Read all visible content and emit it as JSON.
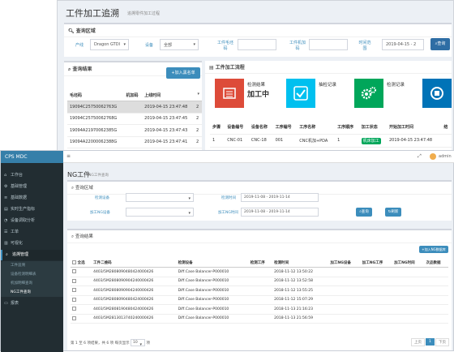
{
  "back": {
    "title": "工件加工追溯",
    "subtitle": "追溯零件加工过程",
    "query": {
      "header": "查询区域",
      "line_label": "产线",
      "line_value": "Dragon GTDI",
      "device_label": "设备",
      "device_value": "全部",
      "part_no_label": "工件毛坯码",
      "part_no_value": "",
      "machine_no_label": "工件机加码",
      "machine_no_value": "",
      "time_label": "时间范围",
      "time_value": "2019-04-15 - 2",
      "query_button": "查询"
    },
    "results": {
      "header": "查询结果",
      "add_blacklist_button": "加入黑名单",
      "columns": [
        "毛坯码",
        "机加码",
        "上线时间",
        ""
      ],
      "rows": [
        [
          "19094C25750062763G",
          "",
          "2019-04-15 23:47:48",
          "2"
        ],
        [
          "19094C25750062768G",
          "",
          "2019-04-15 23:47:45",
          "2"
        ],
        [
          "19094A21970062385G",
          "",
          "2019-04-15 23:47:43",
          "2"
        ],
        [
          "19094A22000062388G",
          "",
          "2019-04-15 23:47:41",
          "2"
        ]
      ]
    },
    "process": {
      "header": "工件加工流程",
      "cards": [
        {
          "label": "检测结果",
          "value": "加工中",
          "color": "#dd4b39",
          "icon": "list-icon"
        },
        {
          "label": "抽检记录",
          "value": "",
          "color": "#00c0ef",
          "icon": "check-icon"
        },
        {
          "label": "检测记录",
          "value": "",
          "color": "#00a65a",
          "icon": "gears-icon"
        },
        {
          "label": "",
          "value": "",
          "color": "#0073b7",
          "icon": "stop-icon"
        }
      ],
      "columns": [
        "步骤",
        "设备编号",
        "设备名称",
        "工序编号",
        "工序名称",
        "工序顺序",
        "加工状态",
        "开始加工时间",
        "结"
      ],
      "rows": [
        {
          "step": "1",
          "device_no": "CNC-01",
          "device_name": "CNC-18",
          "op_no": "001",
          "op_name": "CNC机加+PDA",
          "op_order": "1",
          "status": "机床加工",
          "start": "2019-04-15 23:47:48",
          "end": ""
        }
      ]
    }
  },
  "front": {
    "logo": "CPS MDC",
    "user": "admin",
    "nav": [
      {
        "label": "工作台",
        "icon": "home-icon"
      },
      {
        "label": "基础管理",
        "icon": "gear-icon"
      },
      {
        "label": "基础数据",
        "icon": "database-icon"
      },
      {
        "label": "实时生产指标",
        "icon": "dashboard-icon"
      },
      {
        "label": "设备调取分析",
        "icon": "chart-icon"
      },
      {
        "label": "工单",
        "icon": "list-icon"
      },
      {
        "label": "可视化",
        "icon": "bar-chart-icon"
      },
      {
        "label": "追溯管理",
        "icon": "search-icon"
      }
    ],
    "subnav": [
      "工件追溯",
      "设备检测明细表",
      "机加明细查询",
      "NG工件查询"
    ],
    "nav_after": {
      "label": "报表",
      "icon": "report-icon"
    },
    "page_title": "NG工件",
    "page_subtitle": "NG工件查询",
    "query": {
      "header": "查询区域",
      "check_device_label": "检测设备",
      "check_time_label": "检测时间",
      "check_time_value": "2019-11-08 - 2019-11-14",
      "ng_device_label": "加工NG设备",
      "ng_time_label": "加工NG时间",
      "ng_time_value": "2019-11-08 - 2019-11-14",
      "query_button": "查询",
      "reset_button": "刷新"
    },
    "results": {
      "header": "查询结果",
      "add_button": "加入NG数据库",
      "columns": [
        "全选",
        "工件二维码",
        "检测设备",
        "检测工序",
        "检测时间",
        "加工NG设备",
        "加工NG工序",
        "加工NG时间",
        "次品数据"
      ],
      "rows": [
        [
          "4403/5M2808090480424000426",
          "Diff.Case Balancer-P000010",
          "",
          "2018-11-12 13:50:22"
        ],
        [
          "4403/5M2808090904240000426",
          "Diff.Case Balancer-P000010",
          "",
          "2018-11-12 13:52:58"
        ],
        [
          "4403/5M2808090904240000426",
          "Diff.Case Balancer-P000010",
          "",
          "2018-11-12 13:55:25"
        ],
        [
          "4403/5M2808090480424000426",
          "Diff.Case Balancer-P000010",
          "",
          "2018-11-12 15:07:29"
        ],
        [
          "4403/5M2808190480424000426",
          "Diff.Case Balancer-P000010",
          "",
          "2018-11-13 21:16:23"
        ],
        [
          "4403/5M2813013740240000426",
          "Diff.Case Balancer-P000010",
          "",
          "2018-11-13 21:56:59"
        ]
      ],
      "pager_info": "第 1 至 6 项结果，共 6 项 每页显示",
      "page_size": "10",
      "page_unit": "项",
      "prev": "上页",
      "page": "1",
      "next": "下页"
    }
  }
}
